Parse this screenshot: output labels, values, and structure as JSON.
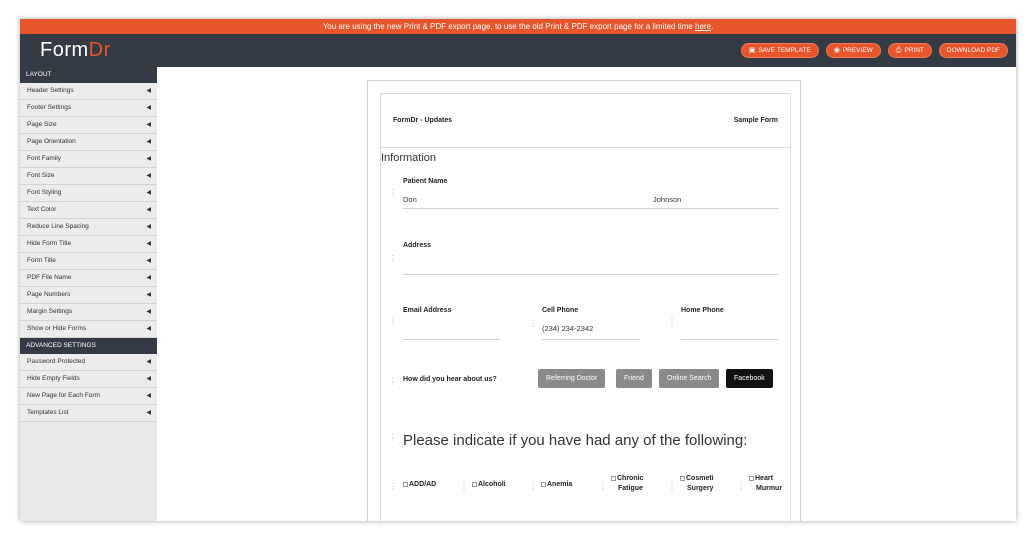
{
  "banner": {
    "text": "You are using the new Print & PDF export page, to use the old Print & PDF export page for a limited time ",
    "link": "here",
    "suffix": "."
  },
  "header": {
    "logo_main": "Form",
    "logo_accent": "Dr",
    "buttons": [
      {
        "label": "SAVE TEMPLATE",
        "icon": "save-icon"
      },
      {
        "label": "PREVIEW",
        "icon": "eye-icon"
      },
      {
        "label": "PRINT",
        "icon": "printer-icon"
      },
      {
        "label": "DOWNLOAD PDF",
        "icon": ""
      }
    ]
  },
  "sidebar": {
    "layout_heading": "LAYOUT",
    "layout_items": [
      "Header Settings",
      "Footer Settings",
      "Page Size",
      "Page Orientation",
      "Font Family",
      "Font Size",
      "Font Styling",
      "Text Color",
      "Reduce Line Spacing",
      "Hide Form Title",
      "Form Title",
      "PDF File Name",
      "Page Numbers",
      "Margin Settings",
      "Show or Hide Forms"
    ],
    "advanced_heading": "ADVANCED SETTINGS",
    "advanced_items": [
      "Password Protected",
      "Hide Empty Fields",
      "New Page for Each Form",
      "Templates List"
    ]
  },
  "form": {
    "header_left": "FormDr - Updates",
    "header_right": "Sample Form",
    "section_title": "Information",
    "patient_name_label": "Patient Name",
    "first_name": "Don",
    "last_name": "Johnson",
    "address_label": "Address",
    "email_label": "Email Address",
    "cell_label": "Cell Phone",
    "cell_value": "(234) 234-2342",
    "home_label": "Home Phone",
    "hear_label": "How did you hear about us?",
    "hear_options": [
      "Referring Doctor",
      "Friend",
      "Online Search",
      "Facebook"
    ],
    "hear_selected": "Facebook",
    "conditions_title": "Please indicate if you have had any of the following:",
    "conditions": [
      {
        "line1": "ADD/AD",
        "line2": ""
      },
      {
        "line1": "Alcoholi",
        "line2": ""
      },
      {
        "line1": "Anemia",
        "line2": ""
      },
      {
        "line1": "Chronic",
        "line2": "Fatigue"
      },
      {
        "line1": "Cosmeti",
        "line2": "Surgery"
      },
      {
        "line1": "Heart",
        "line2": "Murmur"
      }
    ]
  },
  "colors": {
    "accent": "#e8542c",
    "header_bg": "#353b44",
    "sidebar_bg": "#e9e9e9"
  }
}
